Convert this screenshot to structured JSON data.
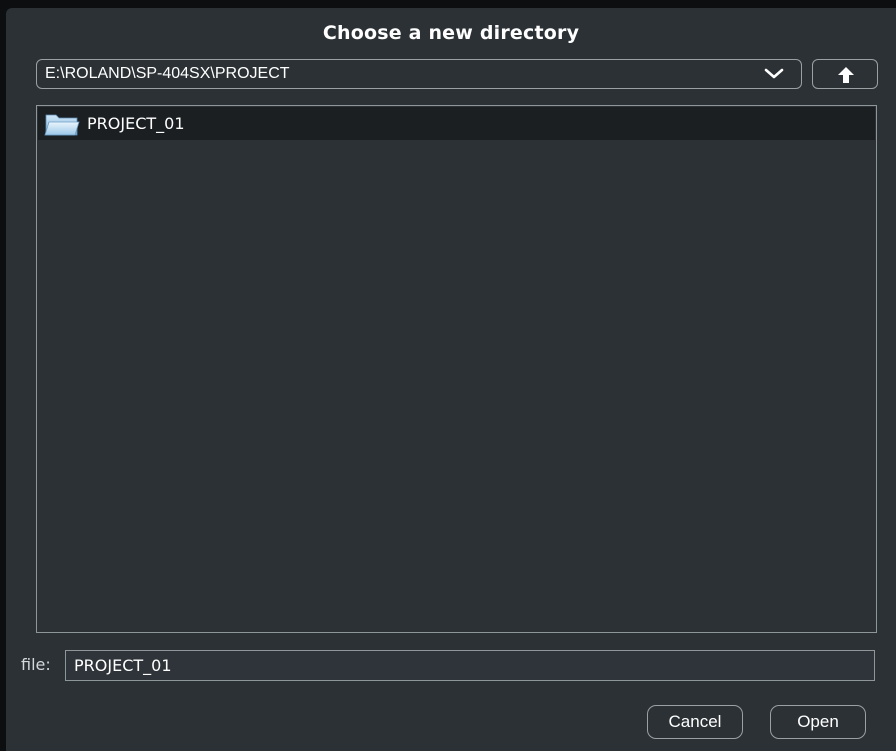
{
  "dialog": {
    "title": "Choose a new directory"
  },
  "path_combo": {
    "value": "E:\\ROLAND\\SP-404SX\\PROJECT",
    "arrow_icon": "chevron-down-icon"
  },
  "up_button": {
    "icon": "arrow-up-icon"
  },
  "file_list": {
    "items": [
      {
        "label": "PROJECT_01",
        "icon": "folder-icon",
        "selected": true
      }
    ]
  },
  "file_field": {
    "label": "file:",
    "value": "PROJECT_01"
  },
  "buttons": {
    "cancel_label": "Cancel",
    "open_label": "Open"
  },
  "colors": {
    "dialog_background": "#2b3135",
    "selection_background": "#1b1f22",
    "border": "#9aa0a4",
    "text": "#ffffff"
  }
}
